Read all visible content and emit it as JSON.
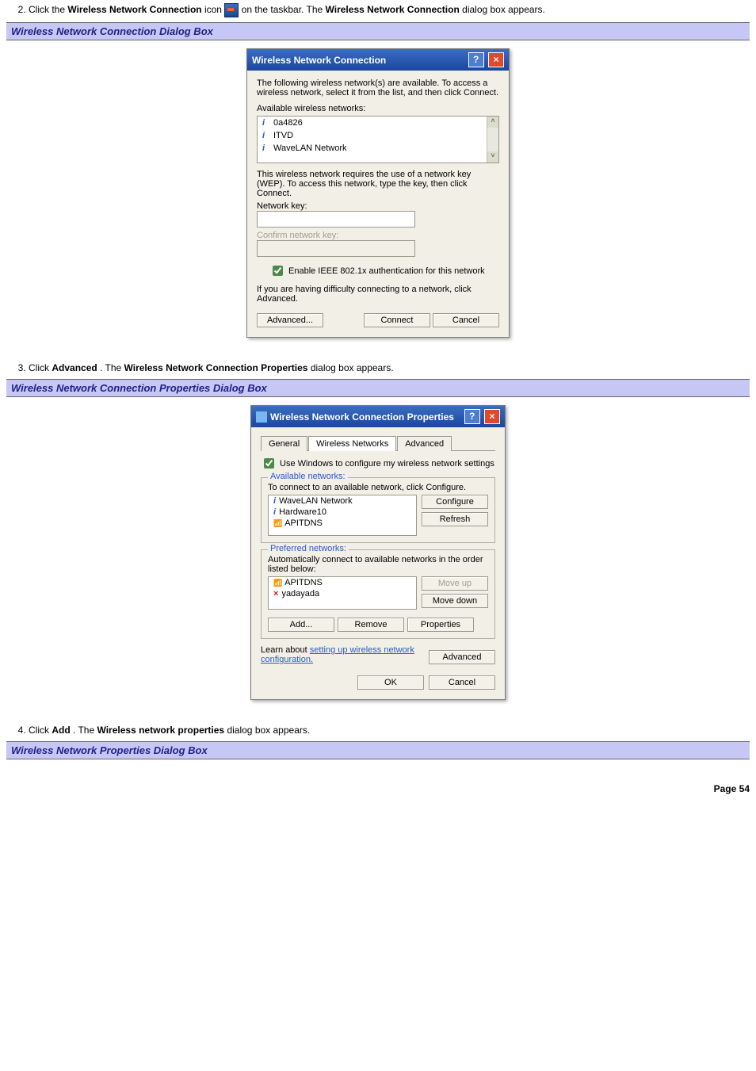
{
  "steps": {
    "s2": {
      "num": "2.",
      "pre": "Click the ",
      "b1": "Wireless Network Connection",
      "mid": " icon ",
      "post": " on the taskbar. The ",
      "b2": "Wireless Network Connection",
      "tail": " dialog box appears."
    },
    "s3": {
      "num": "3.",
      "pre": "Click ",
      "b1": "Advanced",
      "mid": ". The ",
      "b2": "Wireless Network Connection Properties",
      "tail": " dialog box appears."
    },
    "s4": {
      "num": "4.",
      "pre": "Click ",
      "b1": "Add",
      "mid": ". The ",
      "b2": "Wireless network properties",
      "tail": " dialog box appears."
    }
  },
  "headers": {
    "h1": "Wireless Network Connection Dialog Box",
    "h2": "Wireless Network Connection Properties Dialog Box",
    "h3": "Wireless Network Properties Dialog Box"
  },
  "dialog1": {
    "title": "Wireless Network Connection",
    "desc": "The following wireless network(s) are available. To access a wireless network, select it from the list, and then click Connect.",
    "listLabel": "Available wireless networks:",
    "items": [
      "0a4826",
      "ITVD",
      "WaveLAN Network"
    ],
    "wepNote": "This wireless network requires the use of a network key (WEP). To access this network, type the key, then click Connect.",
    "keyLabel": "Network key:",
    "confirmLabel": "Confirm network key:",
    "chk": "Enable IEEE 802.1x authentication for this network",
    "advNote": "If you are having difficulty connecting to a network, click Advanced.",
    "btnAdvanced": "Advanced...",
    "btnConnect": "Connect",
    "btnCancel": "Cancel"
  },
  "dialog2": {
    "title": "Wireless Network Connection Properties",
    "tabs": [
      "General",
      "Wireless Networks",
      "Advanced"
    ],
    "useWindows": "Use Windows to configure my wireless network settings",
    "availLegend": "Available networks:",
    "availDesc": "To connect to an available network, click Configure.",
    "availItems": [
      "WaveLAN Network",
      "Hardware10",
      "APITDNS"
    ],
    "btnConfigure": "Configure",
    "btnRefresh": "Refresh",
    "prefLegend": "Preferred networks:",
    "prefDesc": "Automatically connect to available networks in the order listed below:",
    "prefItems": [
      "APITDNS",
      "yadayada"
    ],
    "btnMoveUp": "Move up",
    "btnMoveDown": "Move down",
    "btnAdd": "Add...",
    "btnRemove": "Remove",
    "btnProperties": "Properties",
    "learnPre": "Learn about ",
    "learnLink": "setting up wireless network configuration.",
    "btnAdvanced": "Advanced",
    "btnOK": "OK",
    "btnCancel": "Cancel"
  },
  "pageNum": "Page 54"
}
